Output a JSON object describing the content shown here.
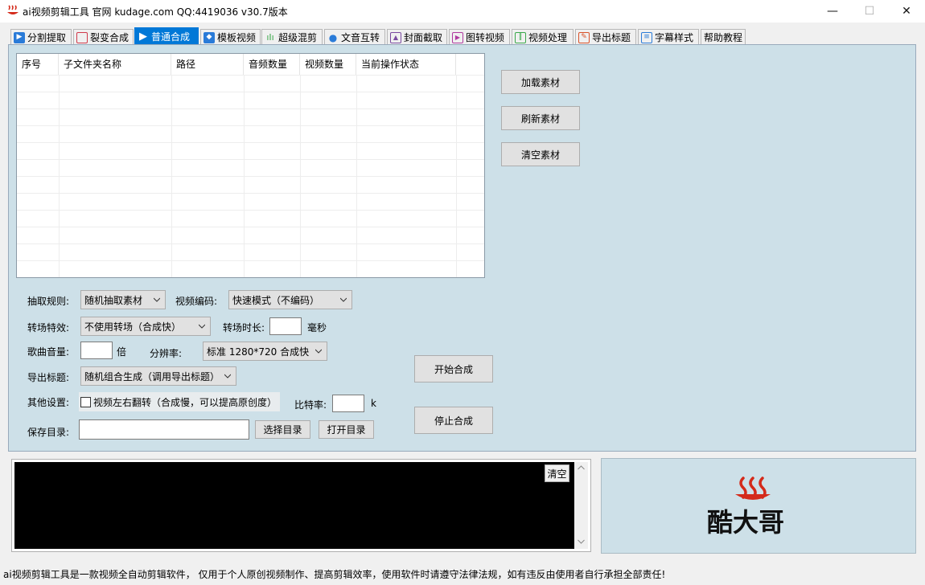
{
  "window": {
    "title": "ai视频剪辑工具 官网 kudage.com QQ:4419036   v30.7版本",
    "minimize": "—",
    "maximize": "☐",
    "close": "✕"
  },
  "tabs": [
    {
      "label": "分割提取",
      "icon": "play-icon",
      "color": "#2a7bd8"
    },
    {
      "label": "裂变合成",
      "icon": "copy-icon",
      "color": "#d0394a"
    },
    {
      "label": "普通合成",
      "icon": "play-icon",
      "color": "#ffffff",
      "active": true
    },
    {
      "label": "模板视频",
      "icon": "bookmark-icon",
      "color": "#2a7bd8"
    },
    {
      "label": "超级混剪",
      "icon": "waveform-icon",
      "color": "#3aa84a"
    },
    {
      "label": "文音互转",
      "icon": "microphone-icon",
      "color": "#2a7bd8"
    },
    {
      "label": "封面截取",
      "icon": "image-icon",
      "color": "#7a4aa0"
    },
    {
      "label": "图转视频",
      "icon": "film-icon",
      "color": "#b03aa0"
    },
    {
      "label": "视频处理",
      "icon": "split-icon",
      "color": "#3aa84a"
    },
    {
      "label": "导出标题",
      "icon": "edit-icon",
      "color": "#d8522a"
    },
    {
      "label": "字幕样式",
      "icon": "subtitle-icon",
      "color": "#2a7bd8"
    },
    {
      "label": "帮助教程",
      "icon": "",
      "color": ""
    }
  ],
  "grid": {
    "columns": [
      "序号",
      "子文件夹名称",
      "路径",
      "音频数量",
      "视频数量",
      "当前操作状态"
    ],
    "rows": []
  },
  "side_buttons": {
    "load": "加载素材",
    "refresh": "刷新素材",
    "clear": "清空素材"
  },
  "settings": {
    "extract_rule_label": "抽取规则:",
    "extract_rule_value": "随机抽取素材",
    "video_codec_label": "视频编码:",
    "video_codec_value": "快速模式（不编码）",
    "transition_effect_label": "转场特效:",
    "transition_effect_value": "不使用转场（合成快）",
    "transition_duration_label": "转场时长:",
    "transition_duration_value": "",
    "transition_duration_unit": "毫秒",
    "song_volume_label": "歌曲音量:",
    "song_volume_value": "",
    "song_volume_unit": "倍",
    "resolution_label": "分辨率:",
    "resolution_value": "标准 1280*720 合成快",
    "export_title_label": "导出标题:",
    "export_title_value": "随机组合生成（调用导出标题）",
    "other_label": "其他设置:",
    "flip_checkbox_label": "视频左右翻转（合成慢，可以提高原创度）",
    "bitrate_label": "比特率:",
    "bitrate_value": "",
    "bitrate_unit": "k",
    "save_dir_label": "保存目录:",
    "save_dir_value": "",
    "choose_dir": "选择目录",
    "open_dir": "打开目录"
  },
  "actions": {
    "start": "开始合成",
    "stop": "停止合成"
  },
  "log": {
    "clear": "清空",
    "text": ""
  },
  "logo": {
    "text": "酷大哥",
    "color": "#d42a1a"
  },
  "status_bar": "ai视频剪辑工具是一款视频全自动剪辑软件， 仅用于个人原创视频制作、提高剪辑效率，使用软件时请遵守法律法规，如有违反由使用者自行承担全部责任!"
}
